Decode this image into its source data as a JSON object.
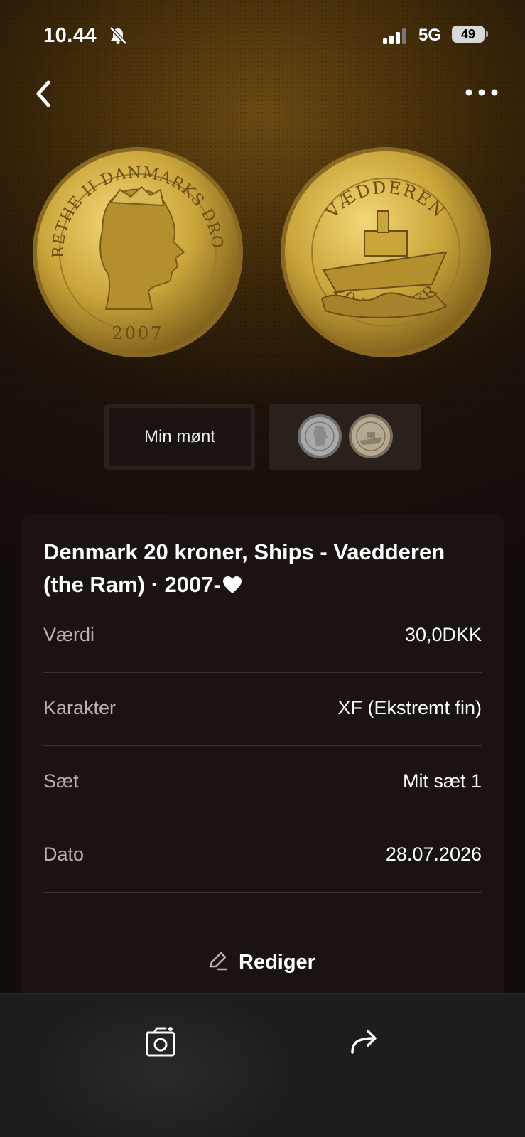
{
  "status_bar": {
    "time": "10.44",
    "network": "5G",
    "battery": "49"
  },
  "icons": {
    "back": "chevron-left-icon",
    "more": "more-horizontal-icon",
    "bell": "bell-off-icon",
    "camera": "camera-icon",
    "share": "share-arrow-icon",
    "edit": "pencil-icon",
    "heart": "heart-icon"
  },
  "coin": {
    "obverse_text": "MARGRETHE II DANMARKS DRONNING",
    "obverse_year": "2007",
    "reverse_text": "VÆDDEREN",
    "reverse_value": "20 KRONER"
  },
  "tabs": {
    "mine_label": "Min mønt"
  },
  "details": {
    "title": "Denmark 20 kroner, Ships - Vaedderen (the Ram) · 2007-",
    "rows": [
      {
        "label": "Værdi",
        "value": "30,0DKK"
      },
      {
        "label": "Karakter",
        "value": "XF (Ekstremt fin)"
      },
      {
        "label": "Sæt",
        "value": "Mit sæt 1"
      },
      {
        "label": "Dato",
        "value": "28.07.2026"
      }
    ],
    "edit_label": "Rediger"
  },
  "colors": {
    "gold": "#c9a53a",
    "card_bg": "#1b1311",
    "accent_text": "#ffffff"
  }
}
